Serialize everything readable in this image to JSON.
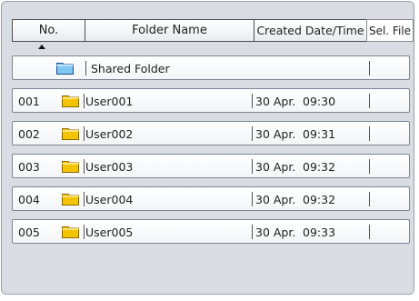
{
  "header": {
    "no_label": "No.",
    "name_label": "Folder Name",
    "date_label": "Created Date/Time",
    "sel_label": "Sel. File"
  },
  "shared_folder": {
    "label": "Shared Folder",
    "icon": "blue-folder-icon"
  },
  "folders": [
    {
      "no": "001",
      "name": "User001",
      "date": "30 Apr.",
      "time": "09:30",
      "icon": "yellow-folder-icon"
    },
    {
      "no": "002",
      "name": "User002",
      "date": "30 Apr.",
      "time": "09:31",
      "icon": "yellow-folder-icon"
    },
    {
      "no": "003",
      "name": "User003",
      "date": "30 Apr.",
      "time": "09:32",
      "icon": "yellow-folder-icon"
    },
    {
      "no": "004",
      "name": "User004",
      "date": "30 Apr.",
      "time": "09:32",
      "icon": "yellow-folder-icon"
    },
    {
      "no": "005",
      "name": "User005",
      "date": "30 Apr.",
      "time": "09:33",
      "icon": "yellow-folder-icon"
    }
  ],
  "colors": {
    "panel_bg": "#d9dde3",
    "shared_folder": "#7fc6f0",
    "user_folder": "#f5c400"
  }
}
